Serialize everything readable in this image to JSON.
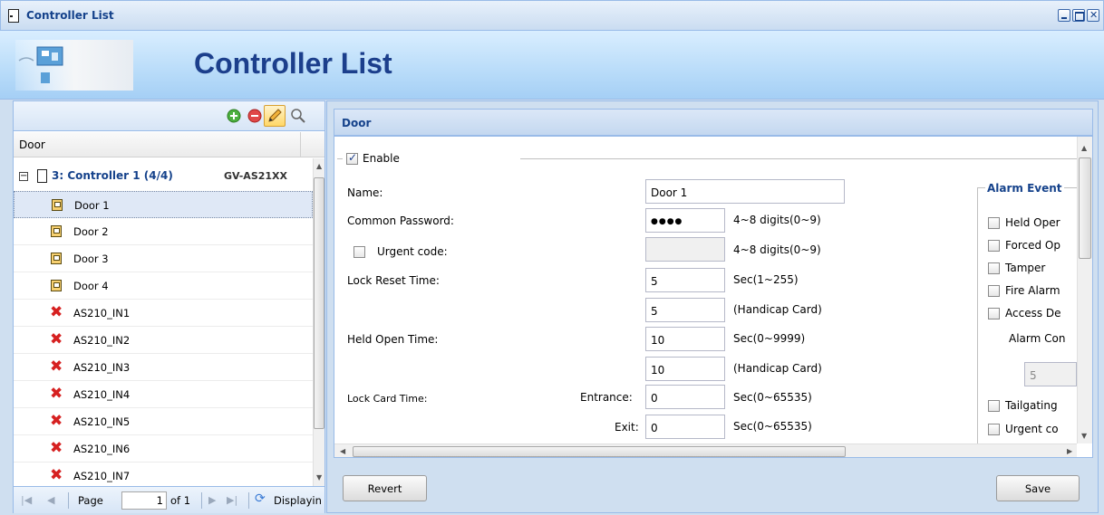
{
  "window": {
    "title": "Controller List",
    "banner_title": "Controller List"
  },
  "tree": {
    "column_header": "Door",
    "controller": {
      "name": "3: Controller 1 (4/4)",
      "model": "GV-AS21XX"
    },
    "items": [
      {
        "label": "Door 1",
        "type": "door",
        "selected": true
      },
      {
        "label": "Door 2",
        "type": "door"
      },
      {
        "label": "Door 3",
        "type": "door"
      },
      {
        "label": "Door 4",
        "type": "door"
      },
      {
        "label": "AS210_IN1",
        "type": "input"
      },
      {
        "label": "AS210_IN2",
        "type": "input"
      },
      {
        "label": "AS210_IN3",
        "type": "input"
      },
      {
        "label": "AS210_IN4",
        "type": "input"
      },
      {
        "label": "AS210_IN5",
        "type": "input"
      },
      {
        "label": "AS210_IN6",
        "type": "input"
      },
      {
        "label": "AS210_IN7",
        "type": "input"
      }
    ]
  },
  "pager": {
    "page_label": "Page",
    "page_value": "1",
    "of_label": "of 1",
    "display_label": "Displayin"
  },
  "door_panel": {
    "title": "Door",
    "enable_label": "Enable",
    "enable_checked": true,
    "fields": {
      "name_label": "Name:",
      "name_value": "Door 1",
      "common_password_label": "Common Password:",
      "common_password_value": "●●●●",
      "common_password_hint": "4~8 digits(0~9)",
      "urgent_code_label": "Urgent code:",
      "urgent_code_hint": "4~8 digits(0~9)",
      "lock_reset_label": "Lock Reset Time:",
      "lock_reset_value": "5",
      "lock_reset_hint": "Sec(1~255)",
      "lock_reset_handicap_value": "5",
      "lock_reset_handicap_hint": "(Handicap Card)",
      "held_open_label": "Held Open Time:",
      "held_open_value": "10",
      "held_open_hint": "Sec(0~9999)",
      "held_open_handicap_value": "10",
      "held_open_handicap_hint": "(Handicap Card)",
      "lock_card_label": "Lock Card Time:",
      "entrance_label": "Entrance:",
      "entrance_value": "0",
      "entrance_hint": "Sec(0~65535)",
      "exit_label": "Exit:",
      "exit_value": "0",
      "exit_hint": "Sec(0~65535)"
    },
    "alarm": {
      "legend": "Alarm Event",
      "items": [
        "Held Oper",
        "Forced Op",
        "Tamper",
        "Fire Alarm",
        "Access De"
      ],
      "alarm_con_label": "Alarm Con",
      "alarm_con_value": "5",
      "items2": [
        "Tailgating",
        "Urgent co"
      ]
    },
    "buttons": {
      "revert": "Revert",
      "save": "Save"
    }
  }
}
